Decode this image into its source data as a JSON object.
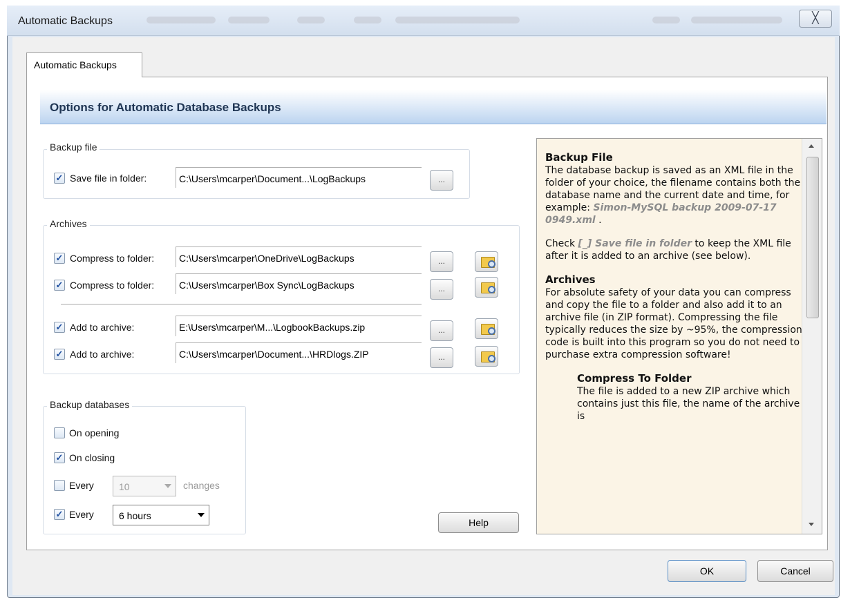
{
  "window": {
    "title": "Automatic Backups",
    "close_label": "╳"
  },
  "tab": {
    "label": "Automatic Backups"
  },
  "header": {
    "title": "Options for Automatic Database Backups"
  },
  "backup_file": {
    "legend": "Backup file",
    "save": {
      "checked": true,
      "label": "Save file in folder:",
      "path": "C:\\Users\\mcarper\\Document...\\LogBackups",
      "browse_label": "..."
    }
  },
  "archives": {
    "legend": "Archives",
    "rows": [
      {
        "checked": true,
        "label": "Compress to folder:",
        "path": "C:\\Users\\mcarper\\OneDrive\\LogBackups",
        "browse_label": "..."
      },
      {
        "checked": true,
        "label": "Compress to folder:",
        "path": "C:\\Users\\mcarper\\Box Sync\\LogBackups",
        "browse_label": "..."
      },
      {
        "checked": true,
        "label": "Add to archive:",
        "path": "E:\\Users\\mcarper\\M...\\LogbookBackups.zip",
        "browse_label": "..."
      },
      {
        "checked": true,
        "label": "Add to archive:",
        "path": "C:\\Users\\mcarper\\Document...\\HRDlogs.ZIP",
        "browse_label": "..."
      }
    ]
  },
  "backup_databases": {
    "legend": "Backup databases",
    "on_opening": {
      "checked": false,
      "label": "On opening"
    },
    "on_closing": {
      "checked": true,
      "label": "On closing"
    },
    "every_changes": {
      "checked": false,
      "label": "Every",
      "value": "10",
      "suffix": "changes"
    },
    "every_time": {
      "checked": true,
      "label": "Every",
      "value": "6 hours"
    }
  },
  "buttons": {
    "help": "Help",
    "ok": "OK",
    "cancel": "Cancel"
  },
  "help": {
    "backup_file_heading": "Backup File",
    "backup_file_text_1": "The database backup is saved as an XML file in the folder of your choice, the filename contains both the database name and the current date and time, for example: ",
    "backup_file_example": "Simon-MySQL backup 2009-07-17 0949.xml",
    "backup_file_text_2": " .",
    "check_text_1": "Check ",
    "check_em": "[_] Save file in folder",
    "check_text_2": " to keep the XML file after it is added to an archive (see below).",
    "archives_heading": "Archives",
    "archives_text": "For absolute safety of your data you can compress and copy the file to a folder and also add it to an archive file (in ZIP format). Compressing the file typically reduces the size by ~95%, the compression code is built into this program so you do not need to purchase extra compression software!",
    "compress_heading": "Compress To Folder",
    "compress_text": "The file is added to a new ZIP archive which contains just this file, the name of the archive is"
  }
}
